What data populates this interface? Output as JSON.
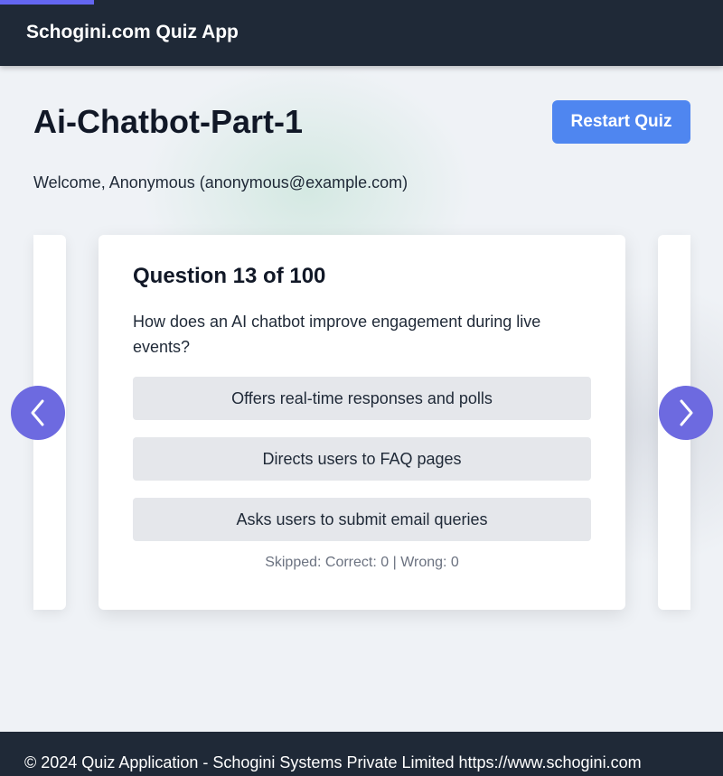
{
  "header": {
    "title": "Schogini.com Quiz App",
    "progress_percent": 13
  },
  "quiz": {
    "title": "Ai-Chatbot-Part-1",
    "restart_label": "Restart Quiz",
    "welcome": "Welcome, Anonymous (anonymous@example.com)"
  },
  "card": {
    "heading": "Question 13 of 100",
    "question": "How does an AI chatbot improve engagement during live events?",
    "options": [
      "Offers real-time responses and polls",
      "Directs users to FAQ pages",
      "Asks users to submit email queries"
    ],
    "status": "Skipped: Correct: 0 | Wrong: 0"
  },
  "icons": {
    "prev": "chevron-left-icon",
    "next": "chevron-right-icon"
  },
  "colors": {
    "header_bg": "#1f2937",
    "progress": "#6366f1",
    "primary_button": "#4f86f0",
    "nav_arrow": "#6d6ae0",
    "option_bg": "#e5e7eb"
  },
  "footer": {
    "text": "© 2024 Quiz Application - Schogini Systems Private Limited https://www.schogini.com"
  }
}
